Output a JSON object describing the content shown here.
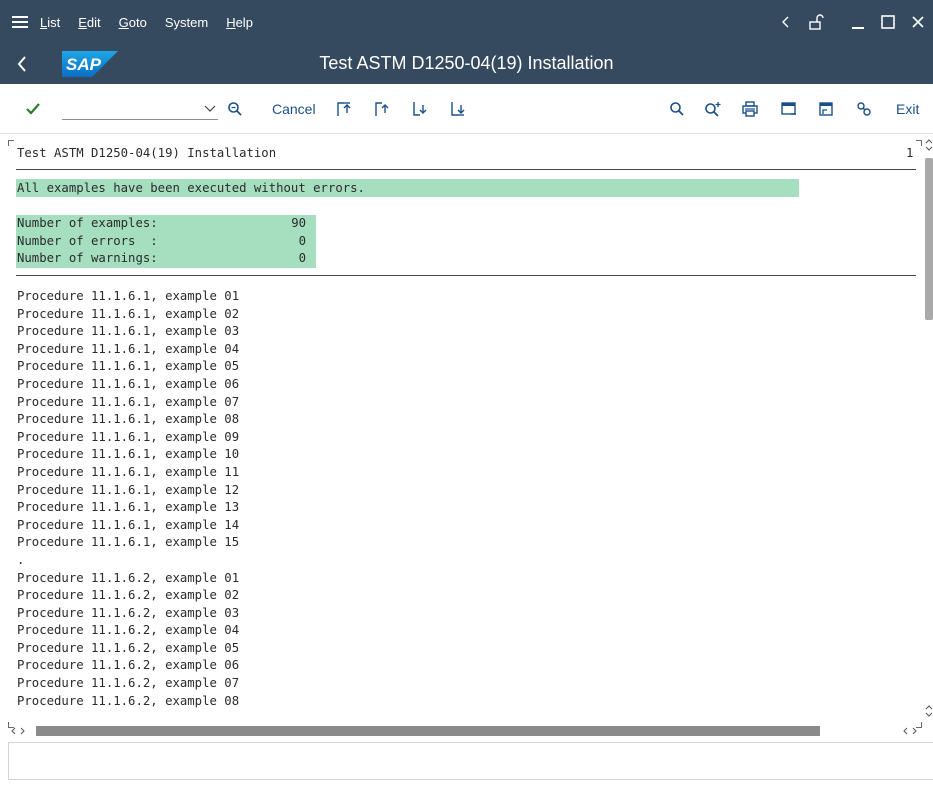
{
  "menu": {
    "items": [
      {
        "label": "List",
        "u": "L",
        "rest": "ist"
      },
      {
        "label": "Edit",
        "u": "E",
        "rest": "dit"
      },
      {
        "label": "Goto",
        "u": "G",
        "rest": "oto"
      },
      {
        "label": "System",
        "u": "",
        "rest": "System"
      },
      {
        "label": "Help",
        "u": "H",
        "rest": "elp"
      }
    ]
  },
  "window": {
    "title": "Test ASTM D1250-04(19) Installation",
    "logo_text": "SAP"
  },
  "toolbar": {
    "okcode_value": "",
    "cancel_label": "Cancel",
    "exit_label": "Exit"
  },
  "list": {
    "header": "Test ASTM D1250-04(19) Installation",
    "page_number": "1",
    "message": "All examples have been executed without errors.",
    "stats": [
      {
        "label": "Number of examples:",
        "value": "90"
      },
      {
        "label": "Number of errors  :",
        "value": "0"
      },
      {
        "label": "Number of warnings:",
        "value": "0"
      }
    ],
    "lines": [
      "Procedure 11.1.6.1, example 01",
      "Procedure 11.1.6.1, example 02",
      "Procedure 11.1.6.1, example 03",
      "Procedure 11.1.6.1, example 04",
      "Procedure 11.1.6.1, example 05",
      "Procedure 11.1.6.1, example 06",
      "Procedure 11.1.6.1, example 07",
      "Procedure 11.1.6.1, example 08",
      "Procedure 11.1.6.1, example 09",
      "Procedure 11.1.6.1, example 10",
      "Procedure 11.1.6.1, example 11",
      "Procedure 11.1.6.1, example 12",
      "Procedure 11.1.6.1, example 13",
      "Procedure 11.1.6.1, example 14",
      "Procedure 11.1.6.1, example 15",
      ".",
      "Procedure 11.1.6.2, example 01",
      "Procedure 11.1.6.2, example 02",
      "Procedure 11.1.6.2, example 03",
      "Procedure 11.1.6.2, example 04",
      "Procedure 11.1.6.2, example 05",
      "Procedure 11.1.6.2, example 06",
      "Procedure 11.1.6.2, example 07",
      "Procedure 11.1.6.2, example 08"
    ]
  },
  "colors": {
    "shell": "#354a5f",
    "highlight": "#a6dfc0",
    "accent": "#1b4f8a",
    "check": "#2b7d2b"
  },
  "icons": [
    "hamburger-icon",
    "back-icon",
    "check-icon",
    "search-icon",
    "first-page-icon",
    "previous-page-icon",
    "next-page-icon",
    "last-page-icon",
    "find-icon",
    "find-next-icon",
    "print-icon",
    "create-session-icon",
    "generate-shortcut-icon",
    "customize-layout-icon",
    "lock-icon",
    "minimize-icon",
    "maximize-icon",
    "close-icon"
  ]
}
